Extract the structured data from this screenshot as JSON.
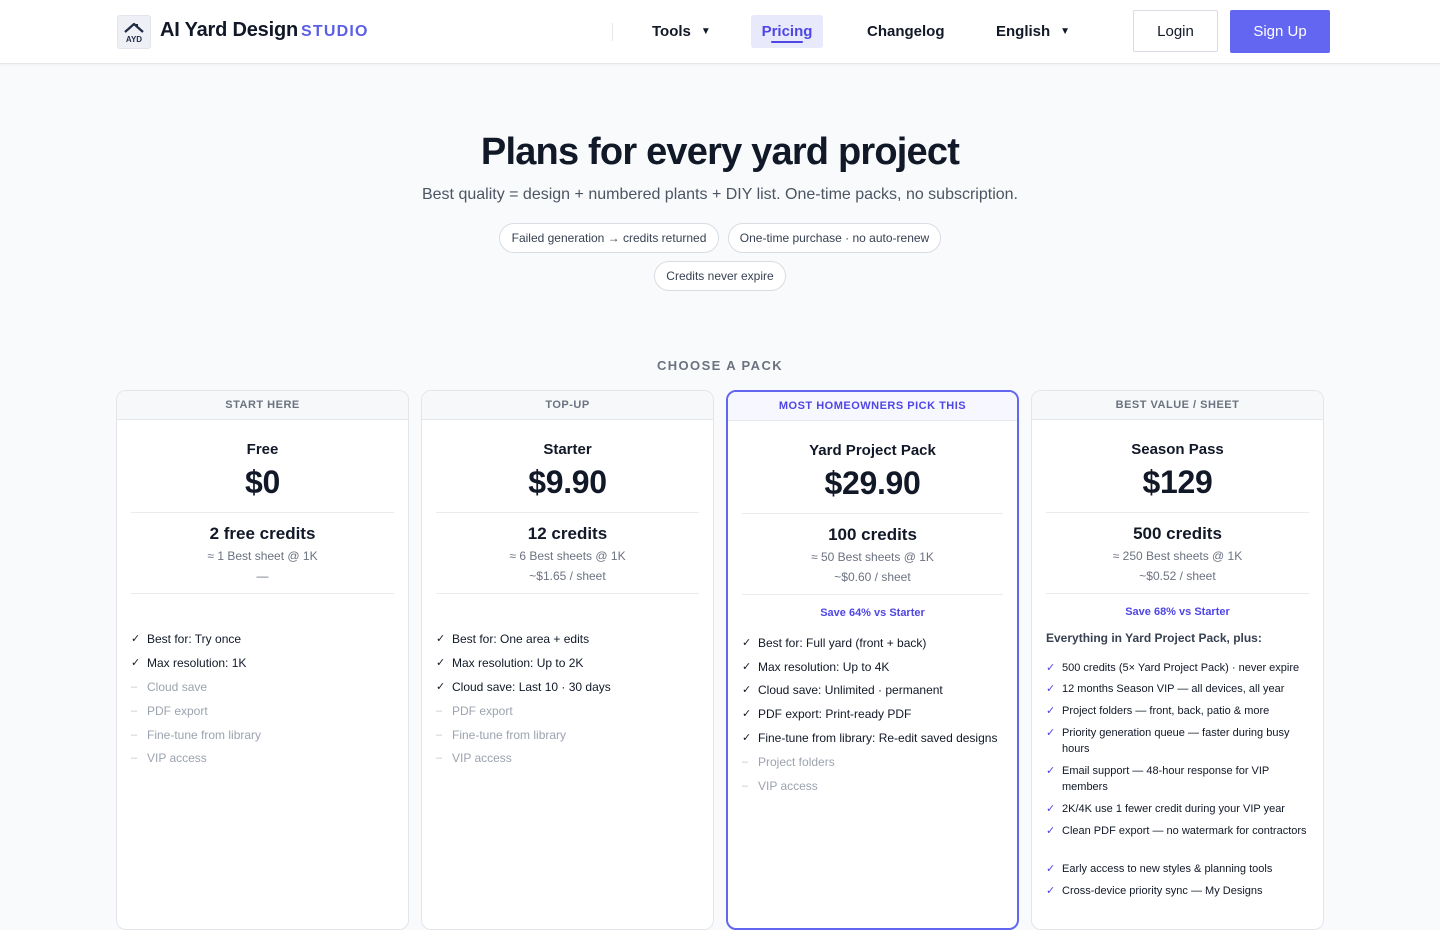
{
  "header": {
    "brand": "AI Yard Design",
    "brand_sub": "STUDIO",
    "logo_text": "AYD",
    "nav": {
      "tools": "Tools",
      "pricing": "Pricing",
      "changelog": "Changelog",
      "language": "English"
    },
    "login": "Login",
    "signup": "Sign Up"
  },
  "hero": {
    "title": "Plans for every yard project",
    "subtitle": "Best quality = design + numbered plants + DIY list. One-time packs, no subscription.",
    "pills": [
      "Failed generation → credits returned",
      "One-time purchase · no auto-renew",
      "Credits never expire"
    ]
  },
  "section_label": "CHOOSE A PACK",
  "plans": [
    {
      "tag": "START HERE",
      "name": "Free",
      "price": "$0",
      "credits": "2 free credits",
      "sheets": "≈ 1 Best sheet @ 1K",
      "per_sheet": "—",
      "features": [
        {
          "text": "Best for: Try once",
          "on": true
        },
        {
          "text": "Max resolution: 1K",
          "on": true
        },
        {
          "text": "Cloud save",
          "on": false
        },
        {
          "text": "PDF export",
          "on": false
        },
        {
          "text": "Fine-tune from library",
          "on": false
        },
        {
          "text": "VIP access",
          "on": false
        }
      ]
    },
    {
      "tag": "TOP-UP",
      "name": "Starter",
      "price": "$9.90",
      "credits": "12 credits",
      "sheets": "≈ 6 Best sheets @ 1K",
      "per_sheet": "~$1.65 / sheet",
      "features": [
        {
          "text": "Best for: One area + edits",
          "on": true
        },
        {
          "text": "Max resolution: Up to 2K",
          "on": true
        },
        {
          "text": "Cloud save: Last 10 · 30 days",
          "on": true
        },
        {
          "text": "PDF export",
          "on": false
        },
        {
          "text": "Fine-tune from library",
          "on": false
        },
        {
          "text": "VIP access",
          "on": false
        }
      ]
    },
    {
      "tag": "MOST HOMEOWNERS PICK THIS",
      "name": "Yard Project Pack",
      "price": "$29.90",
      "credits": "100 credits",
      "sheets": "≈ 50 Best sheets @ 1K",
      "per_sheet": "~$0.60 / sheet",
      "save": "Save 64% vs Starter",
      "features": [
        {
          "text": "Best for: Full yard (front + back)",
          "on": true
        },
        {
          "text": "Max resolution: Up to 4K",
          "on": true
        },
        {
          "text": "Cloud save: Unlimited · permanent",
          "on": true
        },
        {
          "text": "PDF export: Print-ready PDF",
          "on": true
        },
        {
          "text": "Fine-tune from library: Re-edit saved designs",
          "on": true
        },
        {
          "text": "Project folders",
          "on": false
        },
        {
          "text": "VIP access",
          "on": false
        }
      ]
    },
    {
      "tag": "BEST VALUE / SHEET",
      "name": "Season Pass",
      "price": "$129",
      "credits": "500 credits",
      "sheets": "≈ 250 Best sheets @ 1K",
      "per_sheet": "~$0.52 / sheet",
      "save": "Save 68% vs Starter",
      "plus": "Everything in Yard Project Pack, plus:",
      "features": [
        {
          "text": "500 credits (5× Yard Project Pack) · never expire",
          "on": true
        },
        {
          "text": "12 months Season VIP — all devices, all year",
          "on": true
        },
        {
          "text": "Project folders — front, back, patio & more",
          "on": true
        },
        {
          "text": "Priority generation queue — faster during busy hours",
          "on": true
        },
        {
          "text": "Email support — 48-hour response for VIP members",
          "on": true
        },
        {
          "text": "2K/4K use 1 fewer credit during your VIP year",
          "on": true
        },
        {
          "text": "Clean PDF export — no watermark for contractors",
          "on": true
        },
        {
          "text": "Early access to new styles & planning tools",
          "on": true
        },
        {
          "text": "Cross-device priority sync — My Designs",
          "on": true
        }
      ]
    }
  ],
  "icons": {
    "check": "check-icon",
    "dash": "dash-icon",
    "caret": "caret-down-icon",
    "logo": "house-logo-icon"
  },
  "colors": {
    "accent": "#6366f1",
    "accent_text": "#4f46e5",
    "muted": "#9ca3af"
  }
}
